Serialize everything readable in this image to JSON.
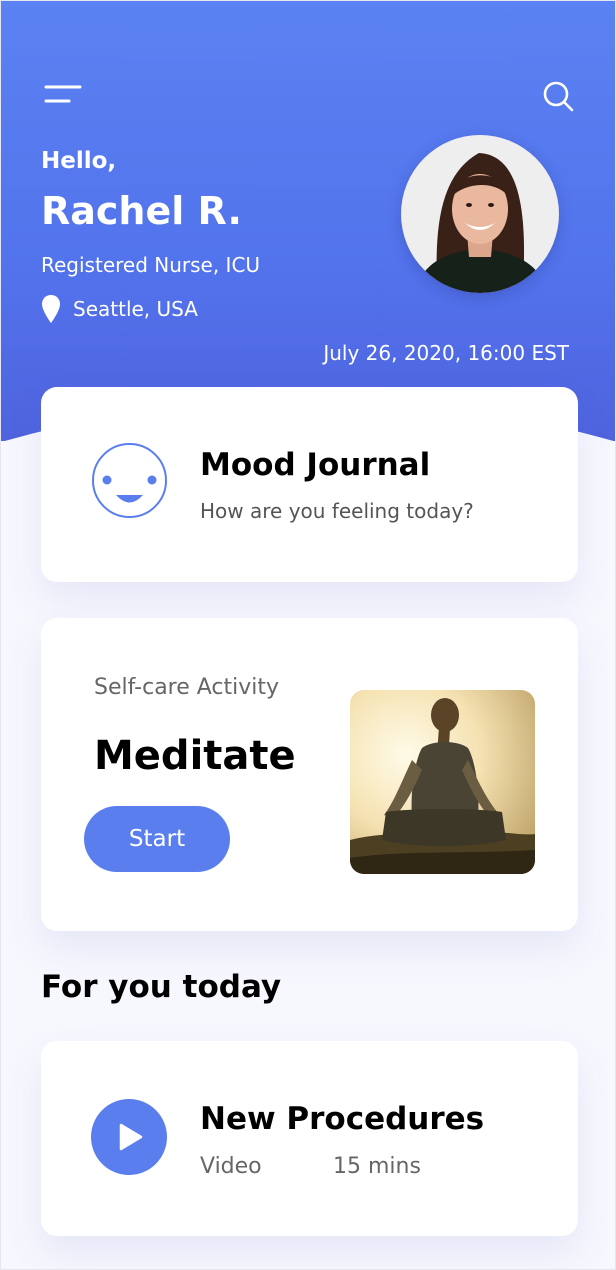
{
  "header": {
    "greeting": "Hello,",
    "name": "Rachel R.",
    "role": "Registered Nurse, ICU",
    "location": "Seattle, USA",
    "datetime": "July 26, 2020, 16:00 EST",
    "menu_icon": "hamburger-menu-icon",
    "search_icon": "search-icon",
    "location_icon": "map-pin-icon"
  },
  "mood_card": {
    "icon": "smiley-face-icon",
    "title": "Mood Journal",
    "subtitle": "How are you feeling today?"
  },
  "activity_card": {
    "label": "Self-care Activity",
    "title": "Meditate",
    "button_label": "Start"
  },
  "for_you": {
    "section_title": "For you today",
    "items": [
      {
        "icon": "play-icon",
        "title": "New Procedures",
        "type": "Video",
        "duration": "15 mins"
      }
    ]
  },
  "colors": {
    "accent": "#5a7eee",
    "header_top": "#5b82f2",
    "header_bottom": "#4f63de",
    "background": "#f7f7fe"
  }
}
